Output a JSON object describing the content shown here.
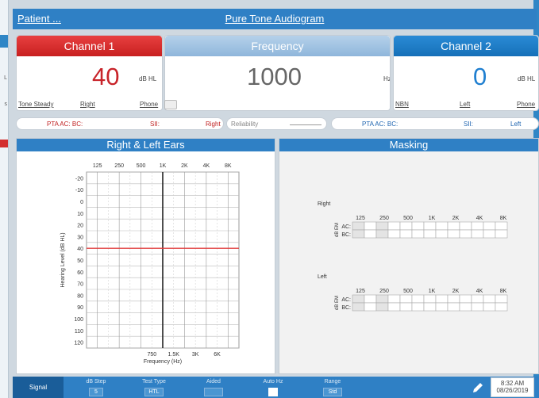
{
  "edge": {
    "labels": [
      "L",
      "s"
    ]
  },
  "header": {
    "patient": "Patient ...",
    "title": "Pure Tone Audiogram"
  },
  "channel1": {
    "label": "Channel 1",
    "value": "40",
    "unit": "dB HL",
    "stimulus": "Tone Steady",
    "ear": "Right",
    "transducer": "Phone"
  },
  "frequency": {
    "label": "Frequency",
    "value": "1000",
    "unit": "Hz"
  },
  "channel2": {
    "label": "Channel 2",
    "value": "0",
    "unit": "dB HL",
    "stimulus": "NBN",
    "ear": "Left",
    "transducer": "Phone"
  },
  "pta_right": {
    "pta": "PTA AC:  BC:",
    "sii": "SII:",
    "ear": "Right"
  },
  "reliability": {
    "label": "Reliability"
  },
  "pta_left": {
    "pta": "PTA AC:  BC:",
    "sii": "SII:",
    "ear": "Left"
  },
  "audiogram": {
    "title": "Right & Left Ears",
    "top_freqs": [
      "125",
      "250",
      "500",
      "1K",
      "2K",
      "4K",
      "8K"
    ],
    "bottom_freqs": [
      "750",
      "1.5K",
      "3K",
      "6K"
    ],
    "levels": [
      "-20",
      "-10",
      "0",
      "10",
      "20",
      "30",
      "40",
      "50",
      "60",
      "70",
      "80",
      "90",
      "100",
      "110",
      "120"
    ],
    "ylabel": "Hearing Level (dB HL)",
    "xlabel": "Frequency (Hz)",
    "current_level": 40,
    "current_freq": "1K",
    "line_color": "#e03b3b"
  },
  "masking": {
    "title": "Masking",
    "right_label": "Right",
    "left_label": "Left",
    "freqs": [
      "125",
      "250",
      "500",
      "1K",
      "2K",
      "4K",
      "8K"
    ],
    "unit": "dB EM",
    "rows": [
      "AC:",
      "BC:"
    ]
  },
  "toolbar": {
    "signal": "Signal",
    "db_step_label": "dB Step",
    "db_step_value": "5",
    "test_type_label": "Test Type",
    "test_type_value": "HTL",
    "aided_label": "Aided",
    "auto_hz_label": "Auto Hz",
    "range_label": "Range",
    "range_value": "Std",
    "edit_icon": "pencil-icon",
    "time": "8:32 AM",
    "date": "08/26/2019"
  }
}
